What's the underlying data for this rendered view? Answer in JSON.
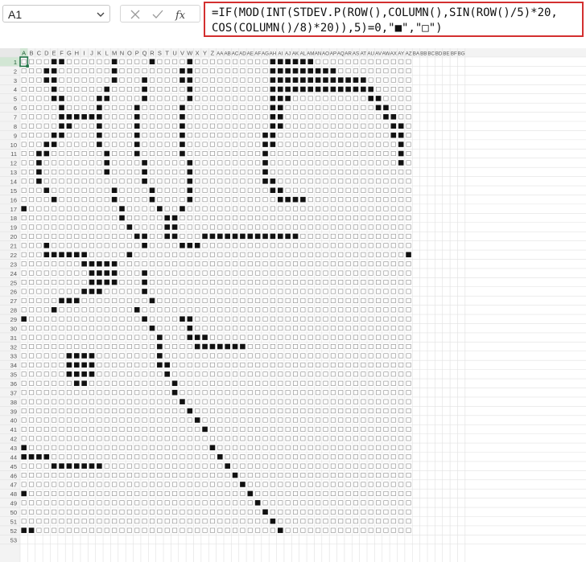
{
  "name_box": {
    "value": "A1"
  },
  "formula_bar": {
    "cancel_icon": "x-icon",
    "enter_icon": "check-icon",
    "fx_label": "fx",
    "formula_line1": "=IF(MOD(INT(STDEV.P(ROW(),COLUMN(),SIN(ROW()/5)*20,",
    "formula_line2": "COS(COLUMN()/8)*20)),5)=0,\"■\",\"□\")",
    "highlight_color": "#d32f2f"
  },
  "sheet": {
    "columns": [
      "A",
      "B",
      "C",
      "D",
      "E",
      "F",
      "G",
      "H",
      "I",
      "J",
      "K",
      "L",
      "M",
      "N",
      "O",
      "P",
      "Q",
      "R",
      "S",
      "T",
      "U",
      "V",
      "W",
      "X",
      "Y",
      "Z",
      "AA",
      "AB",
      "AC",
      "AD",
      "AE",
      "AF",
      "AG",
      "AH",
      "AI",
      "AJ",
      "AK",
      "AL",
      "AM",
      "AN",
      "AO",
      "AP",
      "AQ",
      "AR",
      "AS",
      "AT",
      "AU",
      "AV",
      "AW",
      "AX",
      "AY",
      "AZ",
      "BA",
      "BB",
      "BC",
      "BD",
      "BE",
      "BF",
      "BG"
    ],
    "rows": [
      1,
      2,
      3,
      4,
      5,
      6,
      7,
      8,
      9,
      10,
      11,
      12,
      13,
      14,
      15,
      16,
      17,
      18,
      19,
      20,
      21,
      22,
      23,
      24,
      25,
      26,
      27,
      28,
      29,
      30,
      31,
      32,
      33,
      34,
      35,
      36,
      37,
      38,
      39,
      40,
      41,
      42,
      43,
      44,
      45,
      46,
      47,
      48,
      49,
      50,
      51,
      52,
      53
    ],
    "selected_cell": "A1",
    "filled_symbol": "■",
    "empty_symbol": "□",
    "header_color": "#f3f3f3",
    "selected_header_color": "#d2e6d4",
    "selection_color": "#217346",
    "filled_cells": [
      "E1 F1 M1 R1 W1 AH1 AI1 AJ1 AK1 AL1 AM1",
      "D2 E2 M2 V2 W2 AH2 AI2 AJ2 AK2 AL2 AM2 AN2 AO2 AP2",
      "D3 E3 M3 Q3 V3 W3 AH3 AI3 AJ3 AK3 AL3 AM3 AN3 AO3 AP3 AQ3 AR3 AS3 AT3",
      "E4 L4 Q4 W4 AH4 AI4 AJ4 AK4 AL4 AM4 AN4 AO4 AP4 AQ4 AR4 AS4 AT4 AU4",
      "E5 F5 K5 L5 Q5 W5 AH5 AI5 AJ5 AU5 AV5",
      "F6 K6 P6 V6 AH6 AI6 AV6 AW6",
      "F7 G7 H7 I7 J7 K7 P7 V7 AH7 AI7 AW7 AX7",
      "F8 G8 K8 P8 V8 AH8 AI8 AX8 AY8",
      "E9 F9 K9 P9 V9 AG9 AH9 AX9 AY9",
      "D10 E10 K10 P10 V10 AG10 AH10 AY10",
      "C11 D11 L11 P11 V11 AG11 AY11",
      "C12 L12 Q12 W12 AG12 AY12",
      "C13 L13 Q13 W13 AG13",
      "C14 Q14 W14 AG14 AH14",
      "D15 M15 R15 W15 AH15 AI15",
      "E16 M16 R16 W16 AI16 AJ16 AK16 AL16",
      "A17 N17 S17 V17",
      "N18 T18 U18",
      "O19 T19 U19",
      "P20 Q20 T20 U20 Y20 Z20 AA20 AB20 AC20 AD20 AE20 AF20 AG20 AH20 AI20 AJ20 AK20",
      "D21 Q21 V21 W21 X21",
      "D22 E22 F22 G22 H22 I22 O22 AZ22",
      "I23 J23 K23 L23 M23",
      "J24 K24 L24 M24 Q24",
      "J25 K25 L25 M25 Q25",
      "I26 J26 K26 Q26",
      "F27 G27 H27 R27",
      "E28 P28",
      "A29 Q29 V29 W29",
      "R30 W30",
      "S31 W31 X31 Y31",
      "S32 X32 Y32 Z32 AA32 AB32 AC32 AD32",
      "G33 H33 I33 J33 S33",
      "G34 H34 I34 J34 S34 T34",
      "G35 H35 I35 J35 T35",
      "H36 I36 U36",
      "U37",
      "V38",
      "W39",
      "X40",
      "Y41",
      "A43 Z43",
      "A44 B44 C44 D44 AA44",
      "E45 F45 G45 H45 I45 J45 K45 AB45",
      "AC46",
      "AD47",
      "A48 AE48",
      "AF49",
      "AG50",
      "AH51",
      "A52 B52 AI52"
    ]
  }
}
